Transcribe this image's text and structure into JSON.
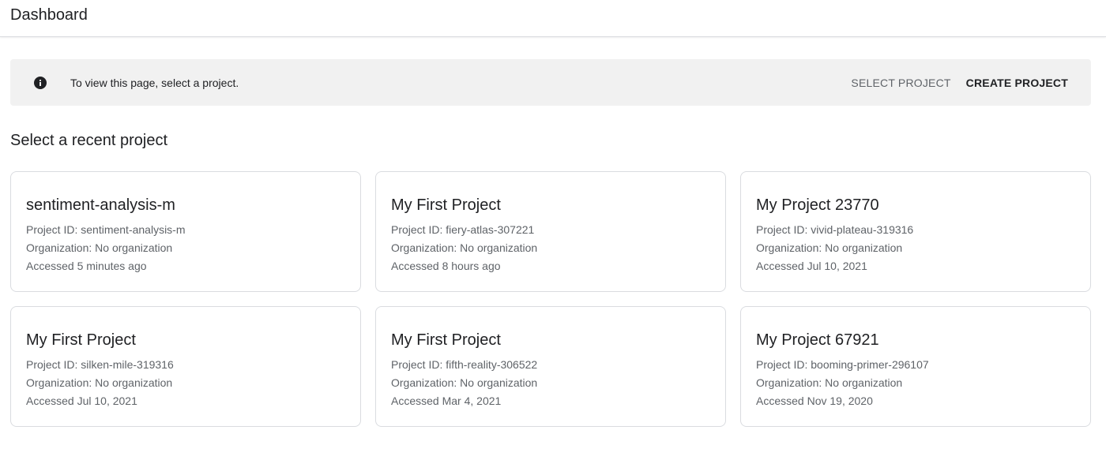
{
  "header": {
    "title": "Dashboard"
  },
  "banner": {
    "icon": "info-icon",
    "message": "To view this page, select a project.",
    "select_label": "SELECT PROJECT",
    "create_label": "CREATE PROJECT"
  },
  "recent": {
    "heading": "Select a recent project",
    "projects": [
      {
        "name": "sentiment-analysis-m",
        "project_id": "Project ID: sentiment-analysis-m",
        "organization": "Organization: No organization",
        "accessed": "Accessed 5 minutes ago"
      },
      {
        "name": "My First Project",
        "project_id": "Project ID: fiery-atlas-307221",
        "organization": "Organization: No organization",
        "accessed": "Accessed 8 hours ago"
      },
      {
        "name": "My Project 23770",
        "project_id": "Project ID: vivid-plateau-319316",
        "organization": "Organization: No organization",
        "accessed": "Accessed Jul 10, 2021"
      },
      {
        "name": "My First Project",
        "project_id": "Project ID: silken-mile-319316",
        "organization": "Organization: No organization",
        "accessed": "Accessed Jul 10, 2021"
      },
      {
        "name": "My First Project",
        "project_id": "Project ID: fifth-reality-306522",
        "organization": "Organization: No organization",
        "accessed": "Accessed Mar 4, 2021"
      },
      {
        "name": "My Project 67921",
        "project_id": "Project ID: booming-primer-296107",
        "organization": "Organization: No organization",
        "accessed": "Accessed Nov 19, 2020"
      }
    ]
  }
}
